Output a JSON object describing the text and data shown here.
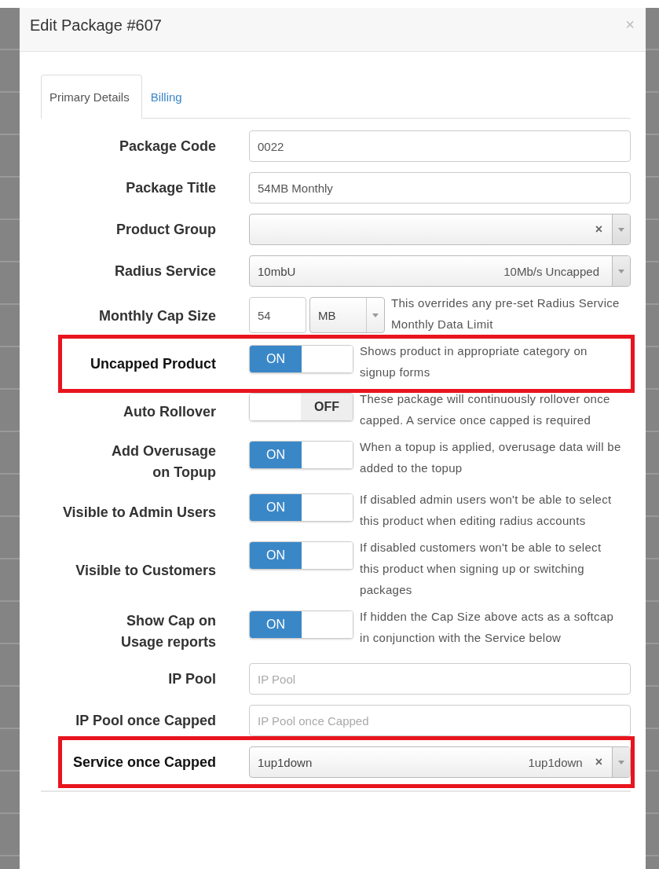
{
  "dialog": {
    "title": "Edit Package #607",
    "close": "×"
  },
  "tabs": [
    {
      "label": "Primary Details",
      "selected": true
    },
    {
      "label": "Billing",
      "selected": false
    }
  ],
  "fields": [
    {
      "kind": "text",
      "label": "Package Code",
      "value": "0022",
      "highlighted": false
    },
    {
      "kind": "text",
      "label": "Package Title",
      "value": "54MB Monthly",
      "highlighted": false
    },
    {
      "kind": "select",
      "label": "Product Group",
      "clearable": true,
      "clear": "×",
      "highlighted": false
    },
    {
      "kind": "select",
      "label": "Radius Service",
      "value": "10mbU",
      "detail": "10Mb/s Uncapped",
      "clearable": false,
      "highlighted": false
    },
    {
      "kind": "cap",
      "label": "Monthly Cap Size",
      "value": "54",
      "unit": "MB",
      "help": "This overrides any pre-set Radius Service Monthly Data Limit",
      "highlighted": false
    },
    {
      "kind": "toggle",
      "label": "Uncapped Product",
      "on": true,
      "on_text": "ON",
      "help": "Shows product in appropriate category on signup forms",
      "highlighted": true
    },
    {
      "kind": "toggle",
      "label": "Auto Rollover",
      "on": false,
      "off_text": "OFF",
      "help": "These package will continuously rollover once capped. A service once capped is required",
      "highlighted": false
    },
    {
      "kind": "toggle",
      "label": "Add Overusage\non Topup",
      "on": true,
      "on_text": "ON",
      "help": "When a topup is applied, overusage data will be added to the topup",
      "highlighted": false
    },
    {
      "kind": "toggle",
      "label": "Visible to Admin Users",
      "on": true,
      "on_text": "ON",
      "help": "If disabled admin users won't be able to select this product when editing radius accounts",
      "highlighted": false
    },
    {
      "kind": "toggle",
      "label": "Visible to Customers",
      "on": true,
      "on_text": "ON",
      "help": "If disabled customers won't be able to select this product when signing up or switching packages",
      "highlighted": false
    },
    {
      "kind": "toggle",
      "label": "Show Cap on\nUsage reports",
      "on": true,
      "on_text": "ON",
      "help": "If hidden the Cap Size above acts as a softcap in conjunction with the Service below",
      "highlighted": false
    },
    {
      "kind": "text",
      "label": "IP Pool",
      "placeholder": "IP Pool",
      "highlighted": false
    },
    {
      "kind": "text",
      "label": "IP Pool once Capped",
      "placeholder": "IP Pool once Capped",
      "highlighted": false
    },
    {
      "kind": "select",
      "label": "Service once Capped",
      "value": "1up1down",
      "detail": "1up1down",
      "clearable": true,
      "clear": "×",
      "highlighted": true
    }
  ]
}
